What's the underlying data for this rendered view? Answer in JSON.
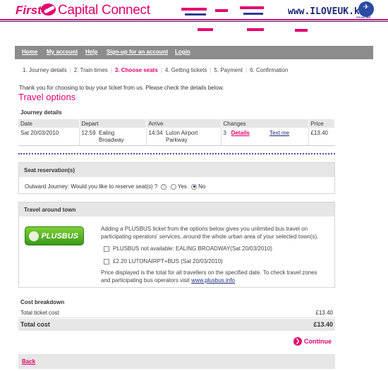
{
  "header": {
    "logo_first": "First",
    "logo_name": "Capital Connect",
    "watermark": "www.ILOVEUK.kr",
    "watermark_badge": "FRONTIER"
  },
  "nav": {
    "items": [
      {
        "label": "Home"
      },
      {
        "label": "My account"
      },
      {
        "label": "Help"
      },
      {
        "label": "Sign-up for an account"
      },
      {
        "label": "Login"
      }
    ]
  },
  "steps": [
    {
      "label": "1. Journey details",
      "active": false
    },
    {
      "label": "2. Train times",
      "active": false
    },
    {
      "label": "3. Choose seats",
      "active": true
    },
    {
      "label": "4. Getting tickets",
      "active": false
    },
    {
      "label": "5. Payment",
      "active": false
    },
    {
      "label": "6. Confirmation",
      "active": false
    }
  ],
  "intro": "Thank you for choosing to buy your ticket from us. Please check the details below.",
  "title": "Travel options",
  "journey": {
    "section_title": "Journey details",
    "headers": {
      "date": "Date",
      "depart": "Depart",
      "arrive": "Arrive",
      "changes": "Changes",
      "price": "Price"
    },
    "row": {
      "date": "Sat 20/03/2010",
      "depart_time": "12:59",
      "depart_station_1": "Ealing",
      "depart_station_2": "Broadway",
      "arrive_time": "14:34",
      "arrive_station_1": "Luton Airport",
      "arrive_station_2": "Parkway",
      "changes": "3",
      "details_link": "Details",
      "text_link": "Text me",
      "price": "£13.40"
    }
  },
  "seat": {
    "heading": "Seat reservation(s)",
    "question": "Outward Journey: Would you like to reserve seat(s) ?",
    "help_glyph": "?",
    "yes_label": "Yes",
    "no_label": "No",
    "selected": "No"
  },
  "travel_town": {
    "heading": "Travel around town",
    "badge": "PLUSBUS",
    "description_line1": "Adding a PLUSBUS ticket from the options below gives you unlimited bus travel on",
    "description_line2": "participating operators' services, around the whole urban area of your selected town(s).",
    "option1": "PLUSBUS not available: EALING BROADWAY(Sat 20/03/2010)",
    "option2": "£2.20 LUTONAIRPT+BUS (Sat 20/03/2010)",
    "note_line1": "Price displayed is the total for all travellers on the specified date. To check travel zones",
    "note_line2": "and participating bus operators visit",
    "link": "www.plusbus.info"
  },
  "cost": {
    "section_title": "Cost breakdown",
    "ticket_label": "Total ticket cost",
    "ticket_value": "£13.40",
    "total_label": "Total cost",
    "total_value": "£13.40"
  },
  "actions": {
    "continue_label": "Continue",
    "continue_glyph": "❯",
    "back_label": "Back"
  },
  "colors": {
    "brand": "#e4006f",
    "navy": "#1e2a78",
    "nav_bg": "#8c8c8c",
    "panel_bg": "#e6e6e6",
    "plusbus_green": "#5fb52a"
  }
}
